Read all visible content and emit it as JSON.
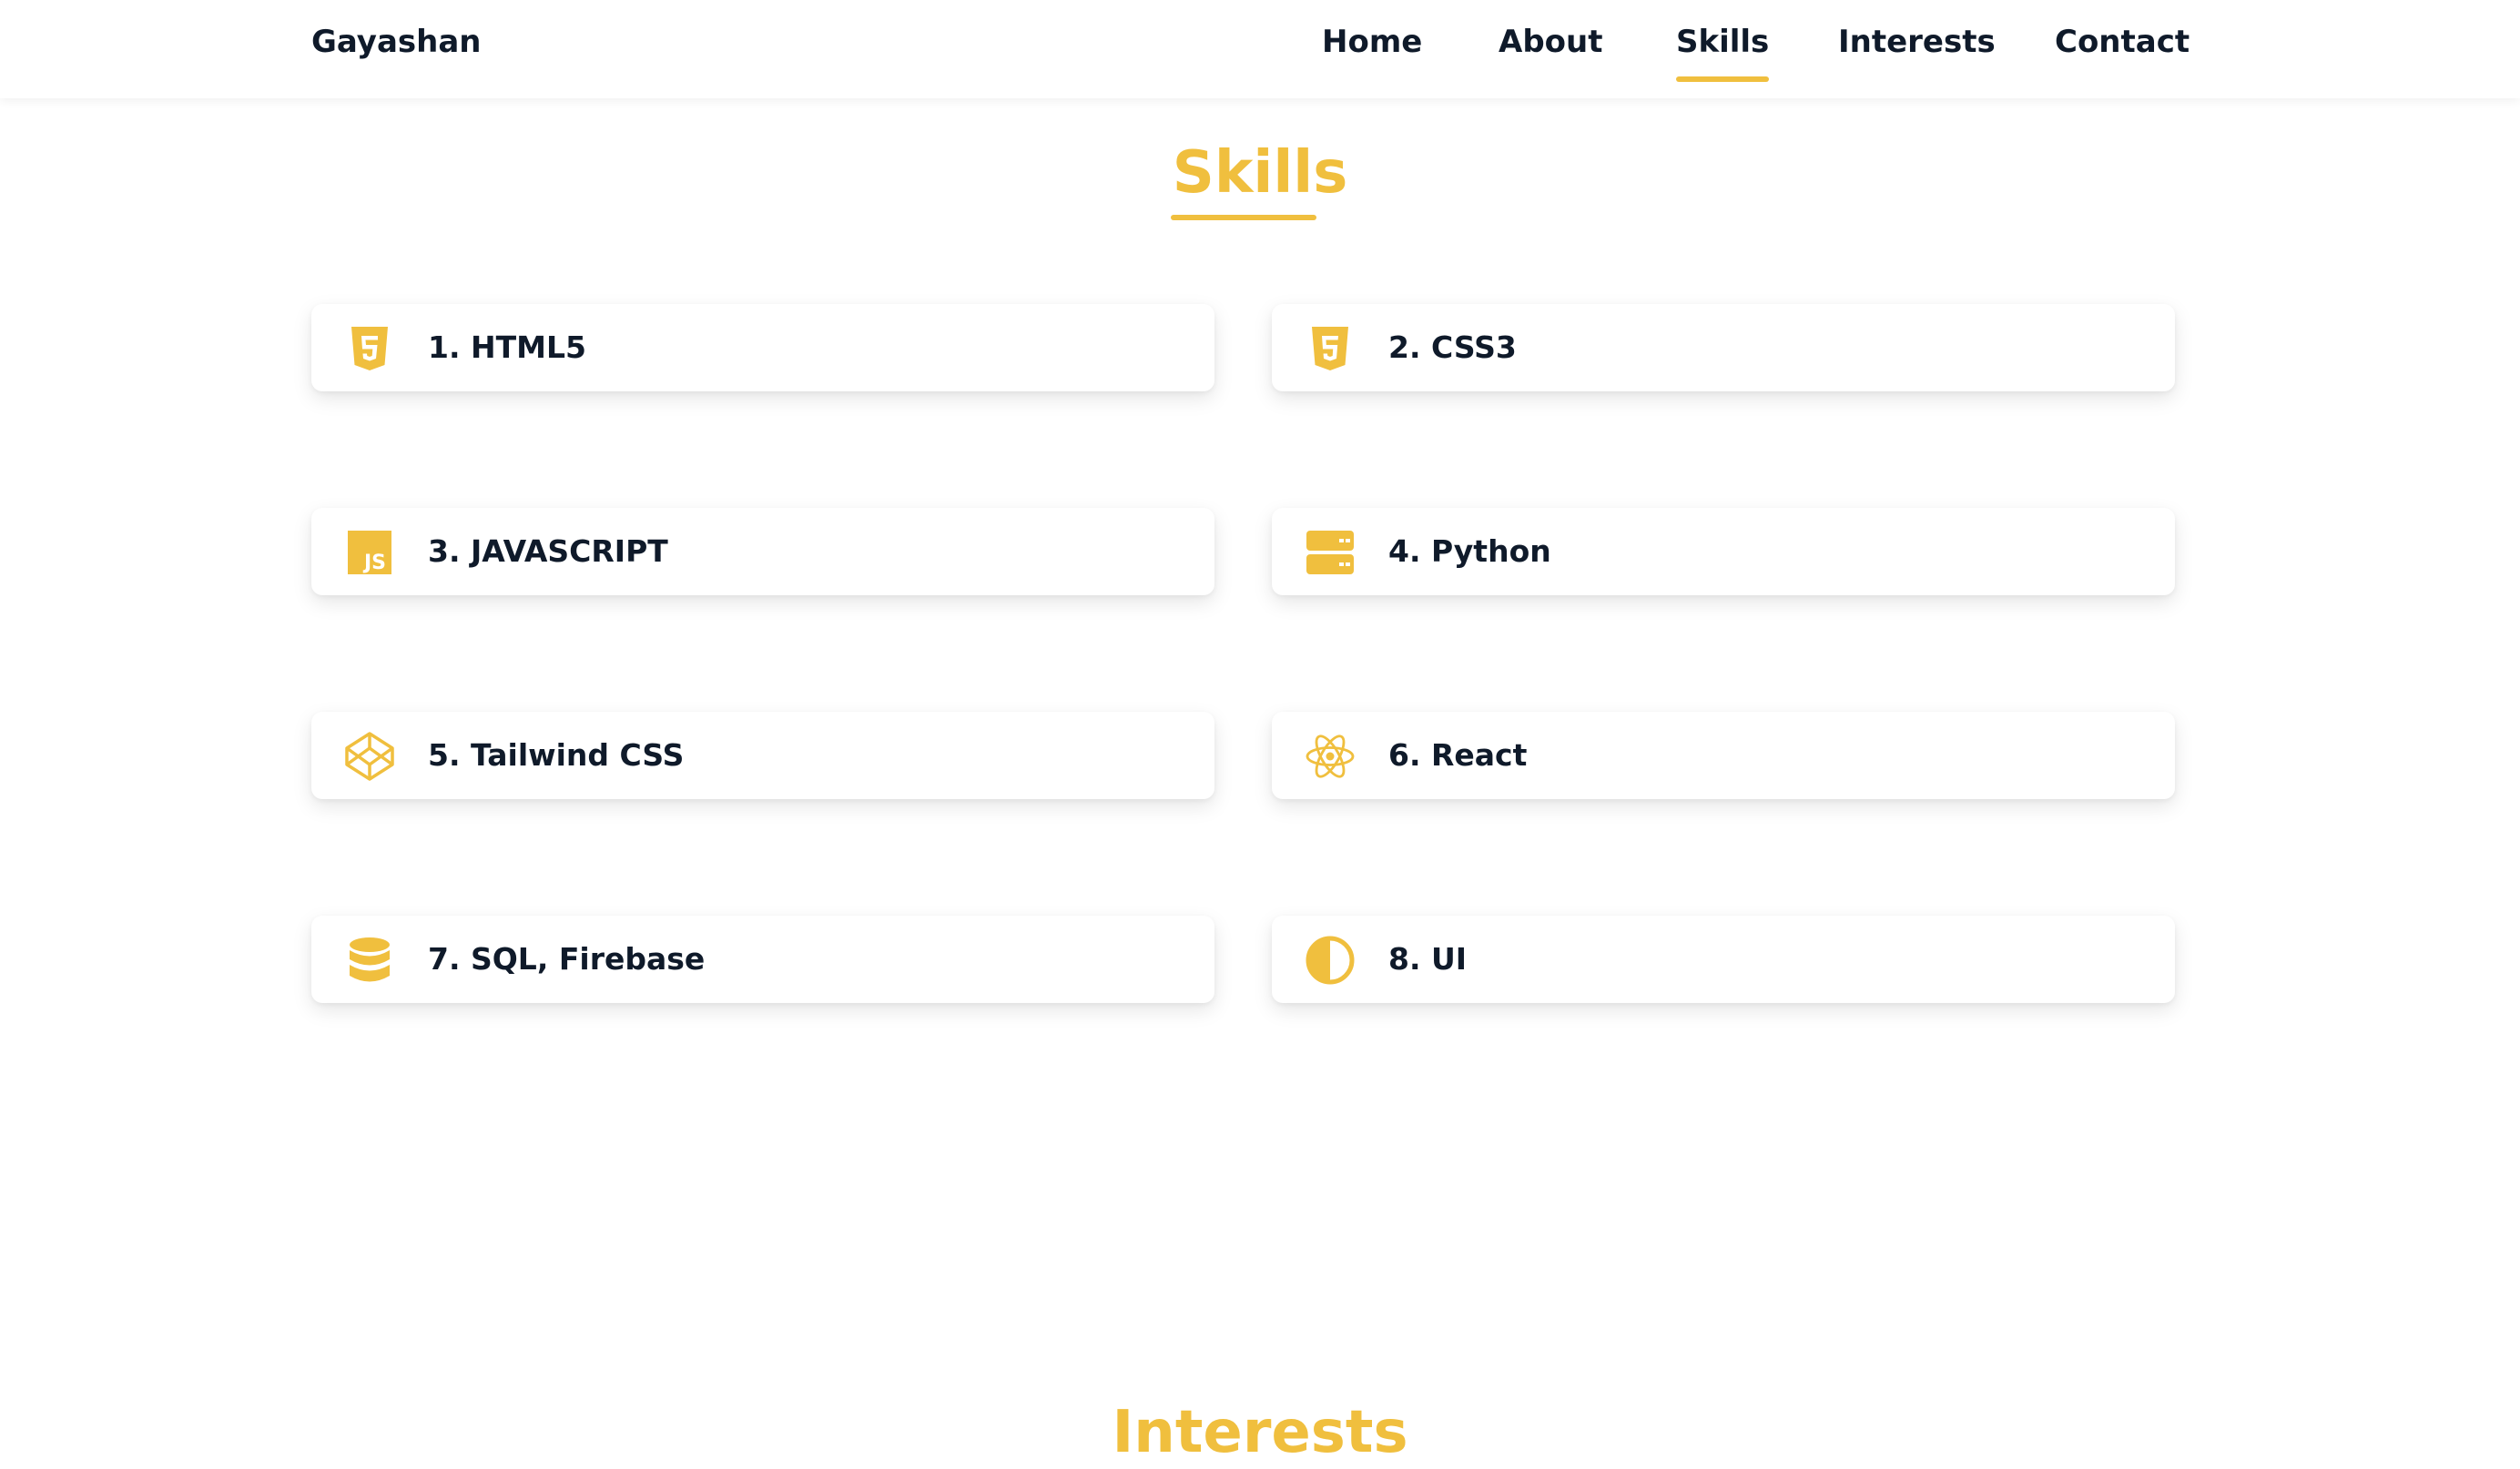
{
  "navbar": {
    "brand": "Gayashan",
    "links": [
      {
        "label": "Home",
        "active": false
      },
      {
        "label": "About",
        "active": false
      },
      {
        "label": "Skills",
        "active": true
      },
      {
        "label": "Interests",
        "active": false
      },
      {
        "label": "Contact",
        "active": false
      }
    ]
  },
  "skills": {
    "title": "Skills",
    "items": [
      {
        "label": "1. HTML5",
        "icon": "html5-icon"
      },
      {
        "label": "2. CSS3",
        "icon": "css3-icon"
      },
      {
        "label": "3. JAVASCRIPT",
        "icon": "javascript-icon"
      },
      {
        "label": "4. Python",
        "icon": "server-icon"
      },
      {
        "label": "5. Tailwind CSS",
        "icon": "codepen-icon"
      },
      {
        "label": "6. React",
        "icon": "react-icon"
      },
      {
        "label": "7. SQL, Firebase",
        "icon": "database-icon"
      },
      {
        "label": "8. UI",
        "icon": "contrast-icon"
      }
    ]
  },
  "interests": {
    "title": "Interests"
  },
  "colors": {
    "accent": "#f0bf3e",
    "text": "#0f1a2a",
    "background": "#ffffff"
  }
}
